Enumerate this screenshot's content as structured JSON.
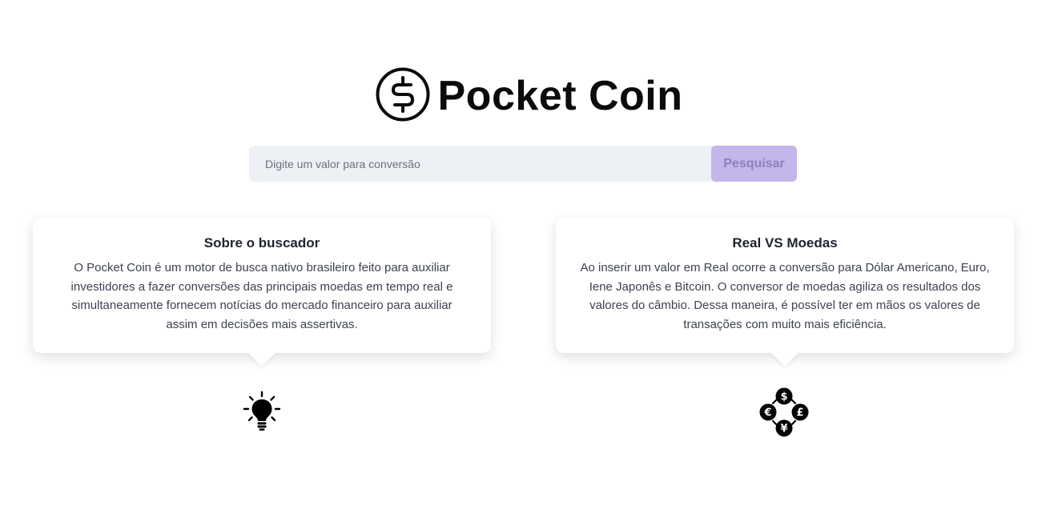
{
  "header": {
    "title": "Pocket Coin",
    "logo_icon": "dollar-coin-icon"
  },
  "search": {
    "placeholder": "Digite um valor para conversão",
    "value": "",
    "button_label": "Pesquisar"
  },
  "cards": [
    {
      "title": "Sobre o buscador",
      "text": "O Pocket Coin é um motor de busca nativo brasileiro feito para auxiliar investidores a fazer conversões das principais moedas em tempo real e simultaneamente fornecem notícias do mercado financeiro para auxiliar assim em decisões mais assertivas.",
      "icon": "lightbulb-icon"
    },
    {
      "title": "Real VS Moedas",
      "text": "Ao inserir um valor em Real ocorre a conversão para Dólar Americano, Euro, Iene Japonês e Bitcoin. O conversor de moedas agiliza os resultados dos valores do câmbio. Dessa maneira, é possível ter em mãos os valores de transações com muito mais eficiência.",
      "icon": "currency-exchange-icon"
    }
  ],
  "colors": {
    "button_bg": "#c4b5ea",
    "button_text": "#8e80bd",
    "input_bg": "#edf1f5"
  }
}
